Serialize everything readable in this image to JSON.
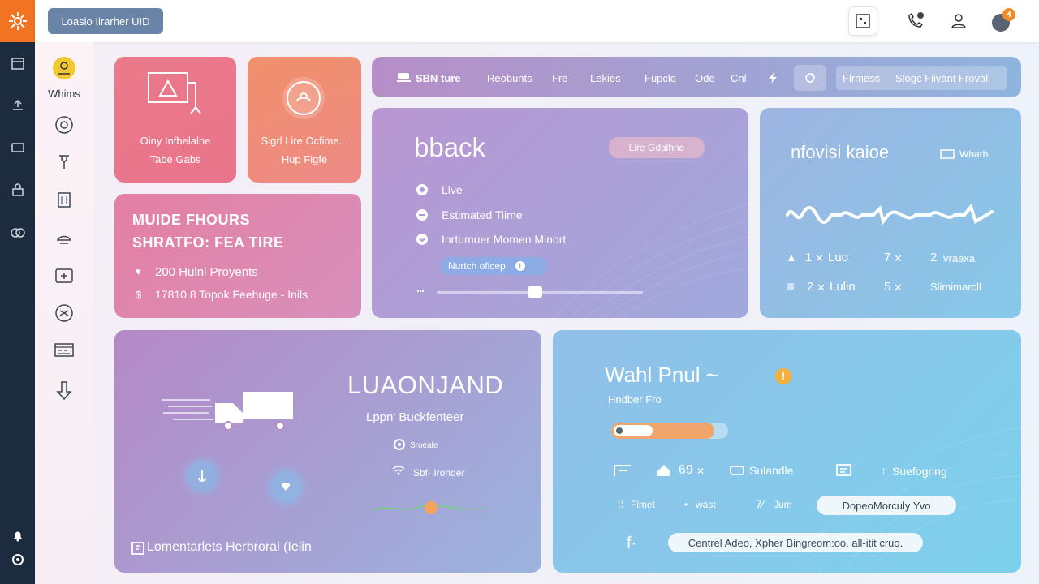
{
  "header": {
    "button_label": "Loasio Iirarher UID"
  },
  "sidebar": {
    "profile_label": "Whims"
  },
  "cards": {
    "card1": {
      "line1": "Oiny Infbelalne",
      "line2": "Tabe Gabs"
    },
    "card2": {
      "line1": "Sigrl Lire Ocfime...",
      "line2": "Hup Figfe"
    },
    "card3": {
      "title1": "MUIDE FHOURS",
      "title2": "SHRATFO: FEA TIRE",
      "row1": "200 Hulnl Proyents",
      "row2_prefix": "$",
      "row2": "17810 8 Topok Feehuge - Inils"
    }
  },
  "toolbar": {
    "brand": "SBN ture",
    "items": [
      "Reobunts",
      "Fre",
      "Lekies",
      "Fupclq",
      "Ode",
      "Cnl"
    ],
    "action1": "Flrmess",
    "action2": "Slogc Fiivant Froval"
  },
  "card5": {
    "title": "bback",
    "badge": "Lire Gdalhne",
    "items": [
      "Live",
      "Estimated Tiime",
      "Inrtumuer Momen Minort"
    ],
    "chip": "Nurtch oficep"
  },
  "card6": {
    "title": "nfovisi kaioe",
    "tag": "Wharb",
    "row1": [
      "1",
      "Luo",
      "7",
      "2",
      "vraexa"
    ],
    "row2": [
      "2",
      "Lulin",
      "5",
      "Slimimarcll"
    ]
  },
  "card7": {
    "title": "LUAONJAND",
    "subtitle": "Lppn' Buckfenteer",
    "meta1": "Sroeale",
    "meta2": "Sbf- Ironder",
    "footer": "Lomentarlets Herbroral (Ielin"
  },
  "card8": {
    "title": "Wahl Pnul ~",
    "subtitle": "Hndber Fro",
    "progress": 0.88,
    "stats": [
      "69",
      "Sulandle",
      "Suefogring"
    ],
    "tags": [
      "Fimet",
      "wast",
      "Jum"
    ],
    "pill": "DopeoMorculy Yvo",
    "info": "Centrel Adeo, Xpher Bingreom:oo. all-itit cruo."
  },
  "colors": {
    "accent_orange": "#f27321",
    "rail": "#1d2b3e",
    "progress_fill": "#f2a56b",
    "header_button": "#6a84a7"
  }
}
